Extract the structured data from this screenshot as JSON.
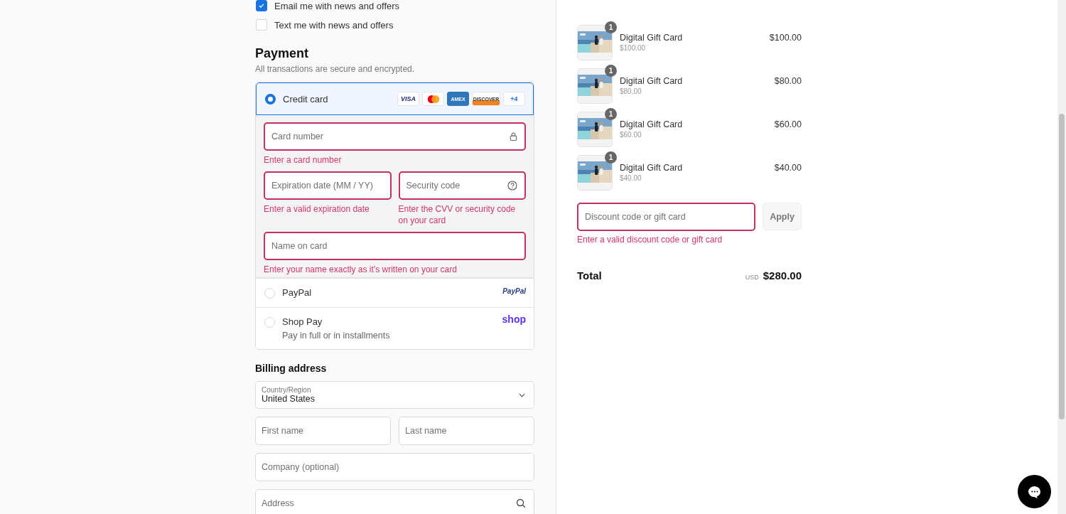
{
  "newsletter": [
    {
      "label": "Email me with news and offers",
      "checked": true
    },
    {
      "label": "Text me with news and offers",
      "checked": false
    }
  ],
  "payment": {
    "title": "Payment",
    "subtitle": "All transactions are secure and encrypted.",
    "methods": [
      {
        "kind": "card",
        "label": "Credit card",
        "selected": true,
        "brands": [
          {
            "kind": "visa",
            "label": "VISA"
          },
          {
            "kind": "mastercard"
          },
          {
            "kind": "amex",
            "label": "AMEX"
          },
          {
            "kind": "discover",
            "label": "DISCOVER"
          },
          {
            "kind": "more",
            "label": "+4"
          }
        ],
        "rows": [
          [
            {
              "kind": "card_number",
              "placeholder": "Card number",
              "error": "Enter a card number"
            }
          ],
          [
            {
              "kind": "expiry",
              "placeholder": "Expiration date (MM / YY)",
              "error": "Enter a valid expiration date"
            },
            {
              "kind": "security_code",
              "placeholder": "Security code",
              "error": "Enter the CVV or security code on your card"
            }
          ],
          [
            {
              "kind": "name",
              "placeholder": "Name on card",
              "error": "Enter your name exactly as it’s written on your card"
            }
          ]
        ]
      },
      {
        "kind": "paypal",
        "label": "PayPal",
        "selected": false,
        "logo": "PayPal"
      },
      {
        "kind": "shoppay",
        "label": "Shop Pay",
        "selected": false,
        "note": "Pay in full or in installments",
        "logo": "shop"
      }
    ]
  },
  "billing": {
    "title": "Billing address",
    "country": {
      "label": "Country/Region",
      "value": "United States"
    },
    "rows": [
      [
        {
          "kind": "text",
          "placeholder": "First name"
        },
        {
          "kind": "text",
          "placeholder": "Last name"
        }
      ],
      [
        {
          "kind": "text",
          "placeholder": "Company (optional)"
        }
      ],
      [
        {
          "kind": "address",
          "placeholder": "Address"
        }
      ]
    ]
  },
  "order": {
    "items": [
      {
        "quantity": "1",
        "name": "Digital Gift Card",
        "unit_price": "$100.00",
        "price": "$100.00"
      },
      {
        "quantity": "1",
        "name": "Digital Gift Card",
        "unit_price": "$80.00",
        "price": "$80.00"
      },
      {
        "quantity": "1",
        "name": "Digital Gift Card",
        "unit_price": "$60.00",
        "price": "$60.00"
      },
      {
        "quantity": "1",
        "name": "Digital Gift Card",
        "unit_price": "$40.00",
        "price": "$40.00"
      }
    ],
    "discount": {
      "placeholder": "Discount code or gift card",
      "error": "Enter a valid discount code or gift card",
      "button": "Apply"
    },
    "total": {
      "label": "Total",
      "currency": "USD",
      "amount": "$280.00"
    }
  }
}
